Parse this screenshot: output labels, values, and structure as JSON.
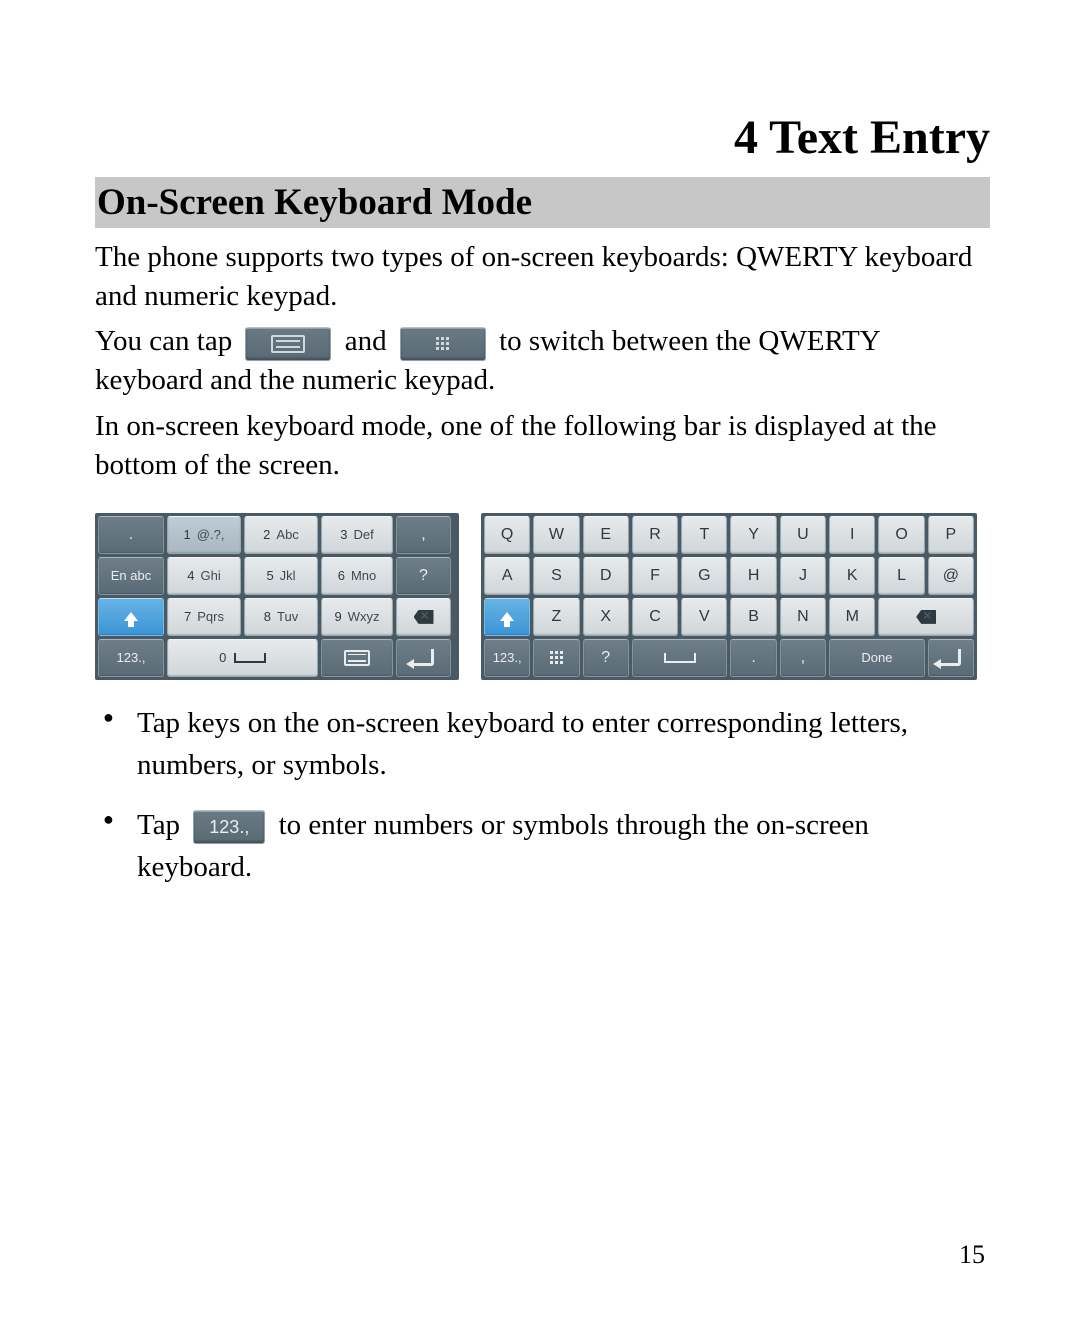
{
  "chapter_title": "4  Text Entry",
  "section_title": "On-Screen Keyboard Mode",
  "para1": "The phone supports two types of on-screen keyboards: QWERTY keyboard and numeric keypad.",
  "para2_pre": "You can tap ",
  "para2_mid": " and ",
  "para2_post": " to switch between the QWERTY keyboard and the numeric keypad.",
  "para3": "In on-screen keyboard mode, one of the following bar is displayed at the bottom of the screen.",
  "bullets": {
    "b1": "Tap keys on the on-screen keyboard to enter corresponding letters, numbers, or symbols.",
    "b2_pre": "Tap  ",
    "b2_post": "  to enter numbers or symbols through the on-screen keyboard."
  },
  "inline_labels": {
    "num_sym": "123.,"
  },
  "numeric_keys": {
    "r1": {
      "k1": ".",
      "k2n": "1",
      "k2s": "@.?,",
      "k3n": "2",
      "k3s": "Abc",
      "k4n": "3",
      "k4s": "Def",
      "k5": ","
    },
    "r2": {
      "k1": "En abc",
      "k2n": "4",
      "k2s": "Ghi",
      "k3n": "5",
      "k3s": "Jkl",
      "k4n": "6",
      "k4s": "Mno",
      "k5": "?"
    },
    "r3": {
      "k2n": "7",
      "k2s": "Pqrs",
      "k3n": "8",
      "k3s": "Tuv",
      "k4n": "9",
      "k4s": "Wxyz"
    },
    "r4": {
      "k1": "123.,",
      "k2n": "0"
    }
  },
  "qwerty_keys": {
    "row1": [
      "Q",
      "W",
      "E",
      "R",
      "T",
      "Y",
      "U",
      "I",
      "O",
      "P"
    ],
    "row2": [
      "A",
      "S",
      "D",
      "F",
      "G",
      "H",
      "J",
      "K",
      "L",
      "@"
    ],
    "row3_letters": [
      "Z",
      "X",
      "C",
      "V",
      "B",
      "N",
      "M"
    ],
    "row4": {
      "k1": "123.,",
      "k3": "?",
      "k5": ".",
      "k6": ",",
      "k7": "Done"
    }
  },
  "page_number": "15"
}
